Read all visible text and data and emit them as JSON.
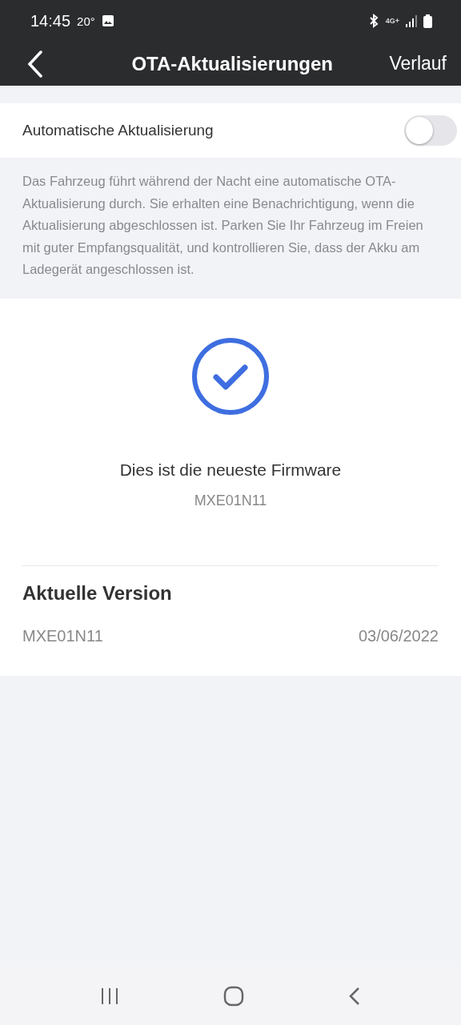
{
  "status_bar": {
    "time": "14:45",
    "temperature": "20°",
    "network": "4G+"
  },
  "header": {
    "title": "OTA-Aktualisierungen",
    "action": "Verlauf"
  },
  "auto_update": {
    "label": "Automatische Aktualisierung",
    "on": false
  },
  "description": "Das Fahrzeug führt während der Nacht eine automatische OTA-Aktualisierung durch. Sie erhalten eine Benachrichtigung, wenn die Aktualisierung abgeschlossen ist. Parken Sie Ihr Fahrzeug im Freien mit guter Empfangsqualität, und kontrollieren Sie, dass der Akku am Ladegerät angeschlossen ist.",
  "status": {
    "message": "Dies ist die neueste Firmware",
    "version": "MXE01N11"
  },
  "current_version": {
    "heading": "Aktuelle Version",
    "version": "MXE01N11",
    "date": "03/06/2022"
  }
}
